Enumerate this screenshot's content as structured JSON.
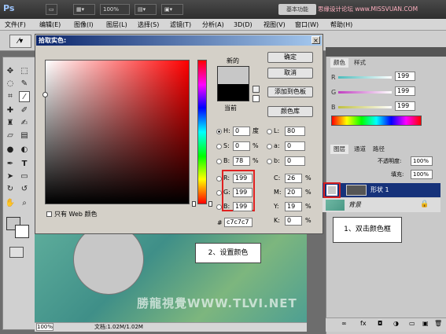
{
  "app": {
    "logo": "Ps",
    "zoom_display": "100%",
    "workspace": "基本功能",
    "site_mark": "思缘设计论坛 www.MISSVUAN.COM"
  },
  "menu": [
    "文件(F)",
    "编辑(E)",
    "图像(I)",
    "图层(L)",
    "选择(S)",
    "滤镜(T)",
    "分析(A)",
    "3D(D)",
    "视图(V)",
    "窗口(W)",
    "帮助(H)"
  ],
  "dialog": {
    "title": "拾取实色:",
    "close": "×",
    "new_label": "新的",
    "current_label": "当前",
    "buttons": {
      "ok": "确定",
      "cancel": "取消",
      "add_swatch": "添加到色板",
      "color_lib": "颜色库"
    },
    "web_only": "只有 Web 颜色",
    "hsb": [
      {
        "key": "H:",
        "value": "0",
        "unit": "度",
        "checked": true
      },
      {
        "key": "S:",
        "value": "0",
        "unit": "%",
        "checked": false
      },
      {
        "key": "B:",
        "value": "78",
        "unit": "%",
        "checked": false
      }
    ],
    "rgb": [
      {
        "key": "R:",
        "value": "199"
      },
      {
        "key": "G:",
        "value": "199"
      },
      {
        "key": "B:",
        "value": "199"
      }
    ],
    "lab": [
      {
        "key": "L:",
        "value": "80"
      },
      {
        "key": "a:",
        "value": "0"
      },
      {
        "key": "b:",
        "value": "0"
      }
    ],
    "cmyk": [
      {
        "key": "C:",
        "value": "26",
        "unit": "%"
      },
      {
        "key": "M:",
        "value": "20",
        "unit": "%"
      },
      {
        "key": "Y:",
        "value": "19",
        "unit": "%"
      },
      {
        "key": "K:",
        "value": "0",
        "unit": "%"
      }
    ],
    "hex_label": "#",
    "hex": "c7c7c7",
    "new_color": "#c7c7c7",
    "current_color": "#000000"
  },
  "callouts": {
    "step1": "1、双击颜色框",
    "step2": "2、设置颜色"
  },
  "panels": {
    "color_tabs": [
      "颜色",
      "样式"
    ],
    "color_rows": [
      {
        "key": "R",
        "value": "199"
      },
      {
        "key": "G",
        "value": "199"
      },
      {
        "key": "B",
        "value": "199"
      }
    ],
    "layer_tabs": [
      "图层",
      "通道",
      "路径"
    ],
    "opacity_label": "不透明度:",
    "opacity": "100%",
    "fill_label": "填充:",
    "fill": "100%",
    "layers": [
      {
        "name": "形状 1",
        "selected": true
      },
      {
        "name": "背景",
        "selected": false
      }
    ]
  },
  "status": {
    "zoom": "100%",
    "doc": "文档:1.02M/1.02M"
  },
  "watermark": "勝龍視覺WWW.TLVI.NET"
}
